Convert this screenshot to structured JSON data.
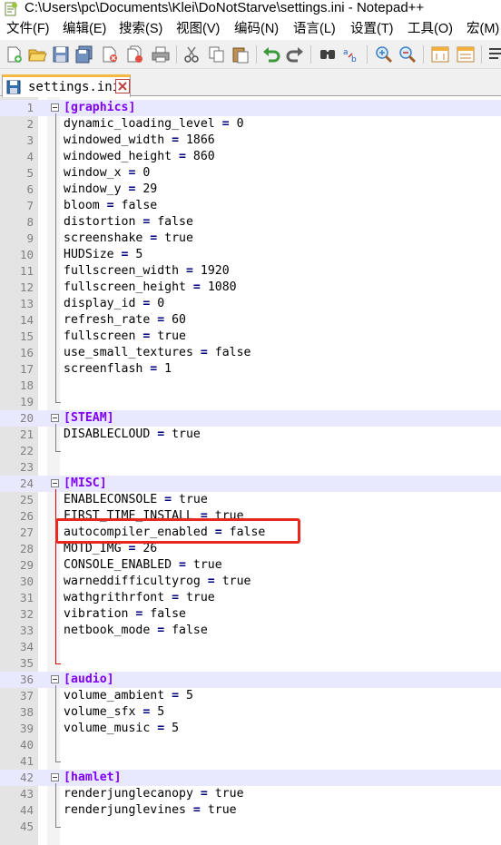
{
  "window": {
    "title": "C:\\Users\\pc\\Documents\\Klei\\DoNotStarve\\settings.ini - Notepad++"
  },
  "menu": [
    "文件(F)",
    "编辑(E)",
    "搜索(S)",
    "视图(V)",
    "编码(N)",
    "语言(L)",
    "设置(T)",
    "工具(O)",
    "宏(M)"
  ],
  "toolbar_icons": [
    "new-file-icon",
    "open-file-icon",
    "save-icon",
    "save-all-icon",
    "close-icon",
    "close-all-icon",
    "print-icon",
    "cut-icon",
    "copy-icon",
    "paste-icon",
    "undo-icon",
    "redo-icon",
    "find-icon",
    "replace-icon",
    "zoom-in-icon",
    "zoom-out-icon",
    "sync-vertical-icon",
    "sync-horizontal-icon",
    "word-wrap-icon"
  ],
  "tab": {
    "label": "settings.ini"
  },
  "editor": {
    "lines": [
      {
        "n": "1",
        "text": "[graphics]",
        "section": true
      },
      {
        "n": "2",
        "key": "dynamic_loading_level",
        "value": "0"
      },
      {
        "n": "3",
        "key": "windowed_width",
        "value": "1866"
      },
      {
        "n": "4",
        "key": "windowed_height",
        "value": "860"
      },
      {
        "n": "5",
        "key": "window_x",
        "value": "0"
      },
      {
        "n": "6",
        "key": "window_y",
        "value": "29"
      },
      {
        "n": "7",
        "key": "bloom",
        "value": "false"
      },
      {
        "n": "8",
        "key": "distortion",
        "value": "false"
      },
      {
        "n": "9",
        "key": "screenshake",
        "value": "true"
      },
      {
        "n": "10",
        "key": "HUDSize",
        "value": "5"
      },
      {
        "n": "11",
        "key": "fullscreen_width",
        "value": "1920"
      },
      {
        "n": "12",
        "key": "fullscreen_height",
        "value": "1080"
      },
      {
        "n": "13",
        "key": "display_id",
        "value": "0"
      },
      {
        "n": "14",
        "key": "refresh_rate",
        "value": "60"
      },
      {
        "n": "15",
        "key": "fullscreen",
        "value": "true"
      },
      {
        "n": "16",
        "key": "use_small_textures",
        "value": "false"
      },
      {
        "n": "17",
        "key": "screenflash",
        "value": "1"
      },
      {
        "n": "18"
      },
      {
        "n": "19"
      },
      {
        "n": "20",
        "text": "[STEAM]",
        "section": true
      },
      {
        "n": "21",
        "key": "DISABLECLOUD",
        "value": "true"
      },
      {
        "n": "22"
      },
      {
        "n": "23"
      },
      {
        "n": "24",
        "text": "[MISC]",
        "section": true
      },
      {
        "n": "25",
        "key": "ENABLECONSOLE",
        "value": "true"
      },
      {
        "n": "26",
        "key": "FIRST_TIME_INSTALL",
        "value": "true"
      },
      {
        "n": "27",
        "key": "autocompiler_enabled",
        "value": "false"
      },
      {
        "n": "28",
        "key": "MOTD_IMG",
        "value": "26"
      },
      {
        "n": "29",
        "key": "CONSOLE_ENABLED",
        "value": "true"
      },
      {
        "n": "30",
        "key": "warneddifficultyrog",
        "value": "true"
      },
      {
        "n": "31",
        "key": "wathgrithrfont",
        "value": "true"
      },
      {
        "n": "32",
        "key": "vibration",
        "value": "false"
      },
      {
        "n": "33",
        "key": "netbook_mode",
        "value": "false"
      },
      {
        "n": "34"
      },
      {
        "n": "35"
      },
      {
        "n": "36",
        "text": "[audio]",
        "section": true
      },
      {
        "n": "37",
        "key": "volume_ambient",
        "value": "5"
      },
      {
        "n": "38",
        "key": "volume_sfx",
        "value": "5"
      },
      {
        "n": "39",
        "key": "volume_music",
        "value": "5"
      },
      {
        "n": "40"
      },
      {
        "n": "41"
      },
      {
        "n": "42",
        "text": "[hamlet]",
        "section": true
      },
      {
        "n": "43",
        "key": "renderjunglecanopy",
        "value": "true"
      },
      {
        "n": "44",
        "key": "renderjunglevines",
        "value": "true"
      },
      {
        "n": "45"
      }
    ]
  },
  "colors": {
    "section_text": "#8000ff",
    "operator": "#000080",
    "highlight_border": "#e8281e",
    "tab_accent": "#f5b942"
  }
}
